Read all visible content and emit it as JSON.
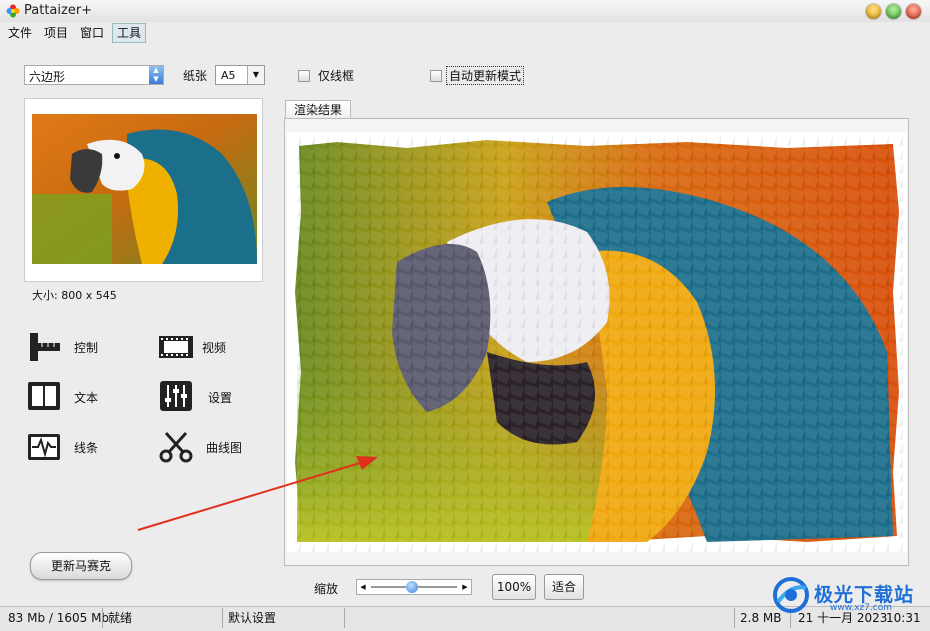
{
  "window": {
    "title": "Pattaizer+"
  },
  "menu": {
    "items": [
      "文件",
      "项目",
      "窗口",
      "工具"
    ],
    "active": "工具"
  },
  "toolbar": {
    "shape_value": "六边形",
    "paper_label": "纸张",
    "paper_value": "A5",
    "frame_only_label": "仅线框",
    "auto_update_label": "自动更新模式"
  },
  "thumbnail": {
    "size_text": "大小: 800 x 545"
  },
  "tools": [
    {
      "label": "控制",
      "icon": "ruler-icon"
    },
    {
      "label": "视频",
      "icon": "film-icon"
    },
    {
      "label": "文本",
      "icon": "book-icon"
    },
    {
      "label": "设置",
      "icon": "sliders-icon"
    },
    {
      "label": "线条",
      "icon": "waveform-icon"
    },
    {
      "label": "曲线图",
      "icon": "scissors-icon"
    }
  ],
  "update_button": "更新马赛克",
  "render": {
    "tab_label": "渲染结果"
  },
  "zoom": {
    "label": "缩放",
    "btn_100": "100%",
    "btn_fit": "适合",
    "level": 0.45
  },
  "status": {
    "memory": "83 Mb / 1605 Mb",
    "state": "就绪",
    "preset": "默认设置",
    "file_size": "2.8 MB",
    "date": "21 十一月 2023",
    "time": "10:31"
  },
  "watermark": {
    "text": "极光下载站",
    "url": "www.xz7.com"
  },
  "colors": {
    "accent_blue": "#1f6fd8",
    "arrow_red": "#e0301e"
  }
}
